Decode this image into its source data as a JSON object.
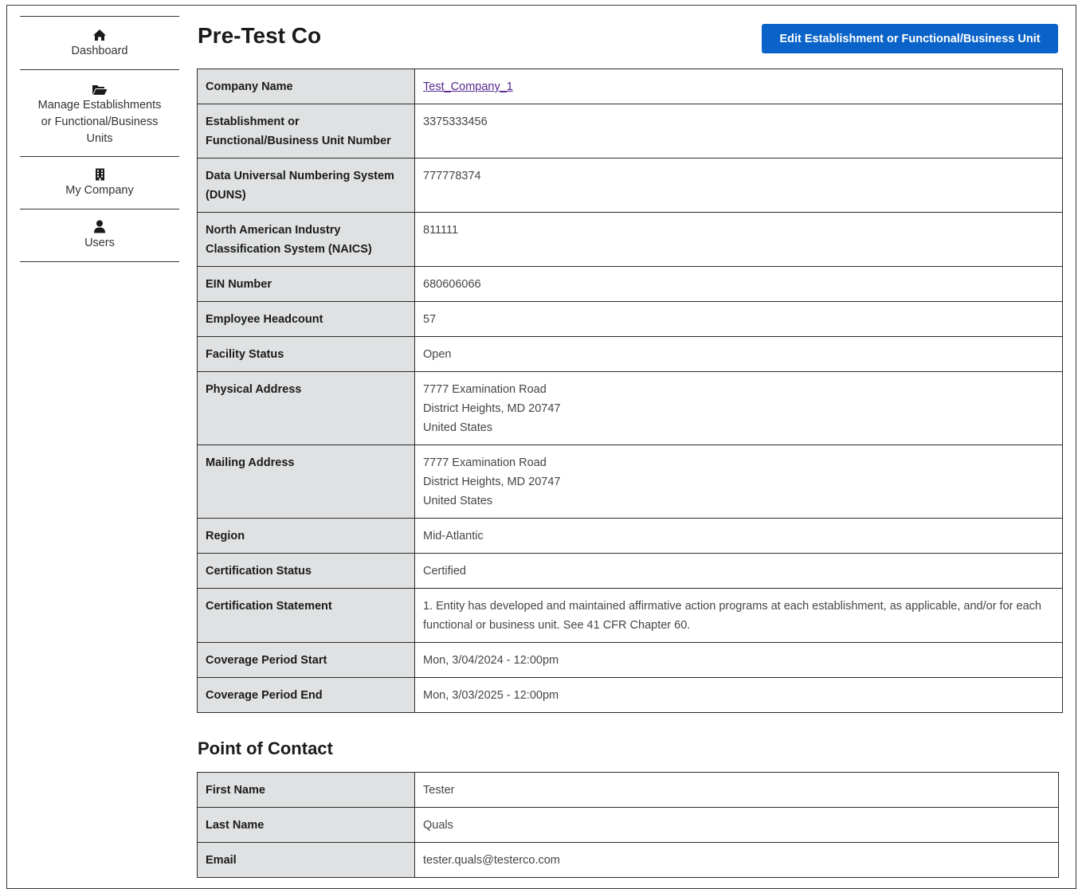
{
  "sidebar": {
    "items": [
      {
        "label": "Dashboard",
        "icon": "home-icon"
      },
      {
        "label_lines": [
          "Manage Establishments",
          "or Functional/Business",
          "Units"
        ],
        "icon": "folder-open-icon"
      },
      {
        "label": "My Company",
        "icon": "building-icon"
      },
      {
        "label": "Users",
        "icon": "user-icon"
      }
    ]
  },
  "header": {
    "title": "Pre-Test Co",
    "edit_button": "Edit Establishment or Functional/Business Unit"
  },
  "company": {
    "rows": [
      {
        "label": "Company Name",
        "value": "Test_Company_1",
        "link": true
      },
      {
        "label": "Establishment or Functional/Business Unit Number",
        "value": "3375333456"
      },
      {
        "label": "Data Universal Numbering System (DUNS)",
        "value": "777778374"
      },
      {
        "label": "North American Industry Classification System (NAICS)",
        "value": "811111"
      },
      {
        "label": "EIN Number",
        "value": "680606066"
      },
      {
        "label": "Employee Headcount",
        "value": "57"
      },
      {
        "label": "Facility Status",
        "value": "Open"
      },
      {
        "label": "Physical Address",
        "lines": [
          "7777 Examination Road",
          "District Heights, MD 20747",
          "United States"
        ]
      },
      {
        "label": "Mailing Address",
        "lines": [
          "7777 Examination Road",
          "District Heights, MD 20747",
          "United States"
        ]
      },
      {
        "label": "Region",
        "value": "Mid-Atlantic"
      },
      {
        "label": "Certification Status",
        "value": "Certified"
      },
      {
        "label": "Certification Statement",
        "value": "1. Entity has developed and maintained affirmative action programs at each establishment, as applicable, and/or for each functional or business unit. See 41 CFR Chapter 60."
      },
      {
        "label": "Coverage Period Start",
        "value": "Mon, 3/04/2024 - 12:00pm"
      },
      {
        "label": "Coverage Period End",
        "value": "Mon, 3/03/2025 - 12:00pm"
      }
    ]
  },
  "contact": {
    "title": "Point of Contact",
    "rows": [
      {
        "label": "First Name",
        "value": "Tester"
      },
      {
        "label": "Last Name",
        "value": "Quals"
      },
      {
        "label": "Email",
        "value": "tester.quals@testerco.com"
      }
    ]
  },
  "colors": {
    "button": "#0a63c9",
    "label_cell": "#dfe1e2",
    "link": "#54278f"
  }
}
